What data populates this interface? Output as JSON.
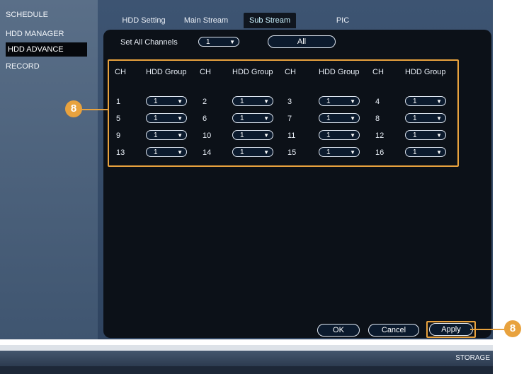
{
  "sidebar": {
    "items": [
      {
        "label": "SCHEDULE",
        "active": false
      },
      {
        "label": "HDD MANAGER",
        "active": false
      },
      {
        "label": "HDD ADVANCE",
        "active": true
      },
      {
        "label": "RECORD",
        "active": false
      }
    ]
  },
  "tabs": [
    {
      "label": "HDD Setting",
      "active": false
    },
    {
      "label": "Main Stream",
      "active": false
    },
    {
      "label": "Sub Stream",
      "active": true
    },
    {
      "label": "PIC",
      "active": false
    }
  ],
  "set_all": {
    "label": "Set All Channels",
    "value": "1",
    "all_button": "All"
  },
  "grid": {
    "headers": [
      "CH",
      "HDD Group",
      "CH",
      "HDD Group",
      "CH",
      "HDD Group",
      "CH",
      "HDD Group"
    ],
    "rows": [
      [
        {
          "ch": "1",
          "group": "1"
        },
        {
          "ch": "2",
          "group": "1"
        },
        {
          "ch": "3",
          "group": "1"
        },
        {
          "ch": "4",
          "group": "1"
        }
      ],
      [
        {
          "ch": "5",
          "group": "1"
        },
        {
          "ch": "6",
          "group": "1"
        },
        {
          "ch": "7",
          "group": "1"
        },
        {
          "ch": "8",
          "group": "1"
        }
      ],
      [
        {
          "ch": "9",
          "group": "1"
        },
        {
          "ch": "10",
          "group": "1"
        },
        {
          "ch": "11",
          "group": "1"
        },
        {
          "ch": "12",
          "group": "1"
        }
      ],
      [
        {
          "ch": "13",
          "group": "1"
        },
        {
          "ch": "14",
          "group": "1"
        },
        {
          "ch": "15",
          "group": "1"
        },
        {
          "ch": "16",
          "group": "1"
        }
      ]
    ]
  },
  "buttons": {
    "ok": "OK",
    "cancel": "Cancel",
    "apply": "Apply"
  },
  "callouts": {
    "grid": "8",
    "apply": "8"
  },
  "footer": {
    "label": "STORAGE"
  },
  "colors": {
    "accent": "#e8a23e",
    "panel": "#0c1118",
    "sidebar": "#4f6580"
  },
  "icons": {
    "dropdown": "chevron-down-icon"
  }
}
